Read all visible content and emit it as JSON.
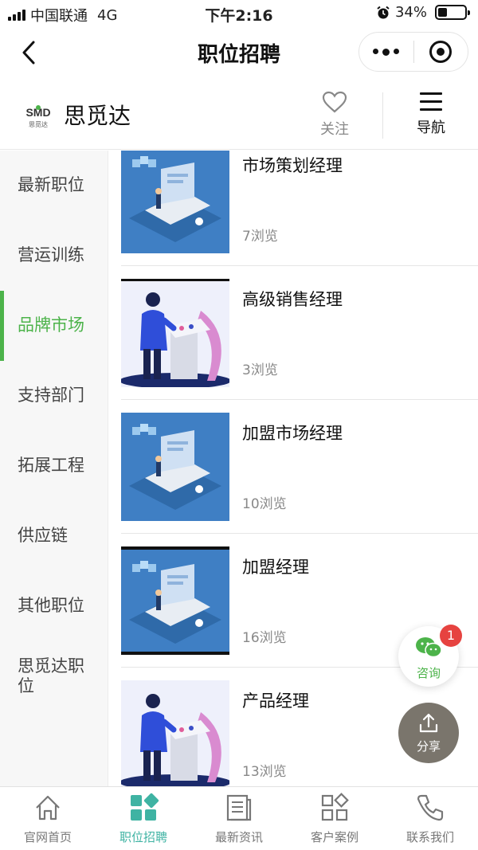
{
  "status_bar": {
    "carrier": "中国联通",
    "network": "4G",
    "time": "下午2:16",
    "battery": "34%",
    "battery_level": 0.34
  },
  "nav": {
    "title": "职位招聘",
    "back_icon": "chevron-left-icon",
    "more_icon": "more-dots-icon",
    "close_icon": "target-icon"
  },
  "brand": {
    "logo_text": "SMD",
    "logo_sub": "思觅达",
    "name": "思觅达",
    "follow_label": "关注",
    "menu_label": "导航"
  },
  "sidebar": {
    "items": [
      {
        "label": "最新职位"
      },
      {
        "label": "营运训练"
      },
      {
        "label": "品牌市场"
      },
      {
        "label": "支持部门"
      },
      {
        "label": "拓展工程"
      },
      {
        "label": "供应链"
      },
      {
        "label": "其他职位"
      },
      {
        "label": "思觅达职位"
      }
    ],
    "active_index": 2
  },
  "jobs": [
    {
      "title": "市场策划经理",
      "views": "7浏览",
      "image": "laptop-illustration"
    },
    {
      "title": "高级销售经理",
      "views": "3浏览",
      "image": "kiosk-illustration"
    },
    {
      "title": "加盟市场经理",
      "views": "10浏览",
      "image": "laptop-illustration"
    },
    {
      "title": "加盟经理",
      "views": "16浏览",
      "image": "laptop-illustration"
    },
    {
      "title": "产品经理",
      "views": "13浏览",
      "image": "kiosk-illustration"
    }
  ],
  "floating": {
    "consult_label": "咨询",
    "consult_badge": "1",
    "share_label": "分享"
  },
  "tabbar": {
    "items": [
      {
        "label": "官网首页",
        "icon": "home-icon"
      },
      {
        "label": "职位招聘",
        "icon": "grid-icon"
      },
      {
        "label": "最新资讯",
        "icon": "news-icon"
      },
      {
        "label": "客户案例",
        "icon": "cases-icon"
      },
      {
        "label": "联系我们",
        "icon": "phone-icon"
      }
    ],
    "active_index": 1
  },
  "colors": {
    "accent_green": "#4cb34a",
    "tab_active": "#3fb3a3",
    "badge_red": "#e64340",
    "share_gray": "#7a756c"
  }
}
